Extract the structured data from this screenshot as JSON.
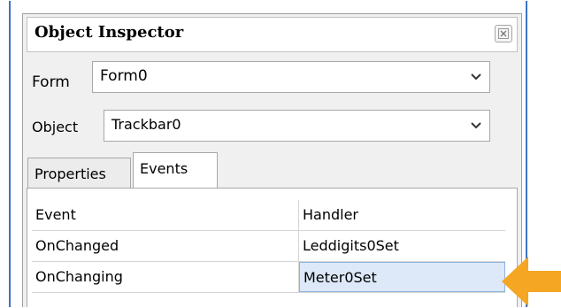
{
  "window": {
    "title": "Object Inspector"
  },
  "form_field": {
    "label": "Form",
    "value": "Form0"
  },
  "object_field": {
    "label": "Object",
    "value": "Trackbar0"
  },
  "tabs": [
    {
      "label": "Properties",
      "active": false
    },
    {
      "label": "Events",
      "active": true
    }
  ],
  "grid": {
    "headers": [
      "Event",
      "Handler"
    ],
    "rows": [
      {
        "event": "OnChanged",
        "handler": "Leddigits0Set"
      },
      {
        "event": "OnChanging",
        "handler": "Meter0Set",
        "selected": true
      }
    ]
  },
  "colors": {
    "pointer_arrow": "#f5a623",
    "frame_border": "#3b73c7",
    "selection": "#dde9f8"
  },
  "icons": [
    "close-icon",
    "chevron-down-icon",
    "pointer-arrow-icon"
  ]
}
